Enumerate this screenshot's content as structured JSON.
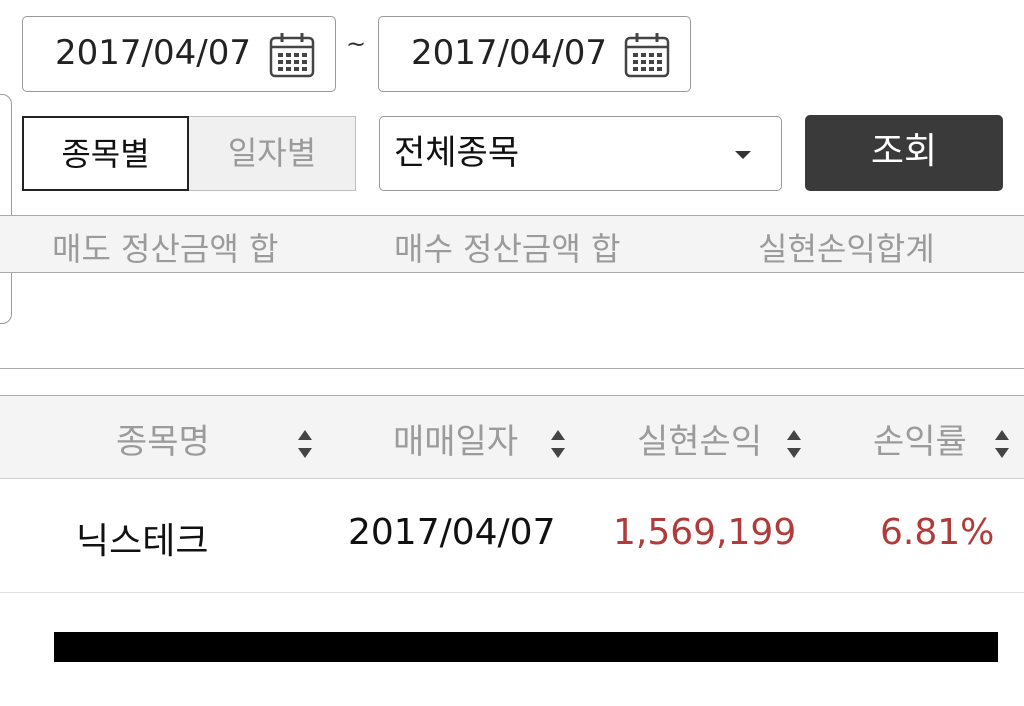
{
  "date_range": {
    "start": "2017/04/07",
    "separator": "~",
    "end": "2017/04/07"
  },
  "view_tabs": [
    {
      "label": "종목별",
      "active": true
    },
    {
      "label": "일자별",
      "active": false
    }
  ],
  "stock_select": {
    "value": "전체종목"
  },
  "search_button": {
    "label": "조회"
  },
  "summary": {
    "headers": [
      "매도 정산금액 합",
      "매수 정산금액 합",
      "실현손익합계"
    ]
  },
  "table": {
    "columns": [
      "종목명",
      "매매일자",
      "실현손익",
      "손익률"
    ],
    "rows": [
      {
        "name": "닉스테크",
        "date": "2017/04/07",
        "profit": "1,569,199",
        "rate": "6.81%"
      }
    ]
  },
  "colors": {
    "profit_positive": "#b13a3a",
    "button_bg": "#3a3a3a"
  }
}
